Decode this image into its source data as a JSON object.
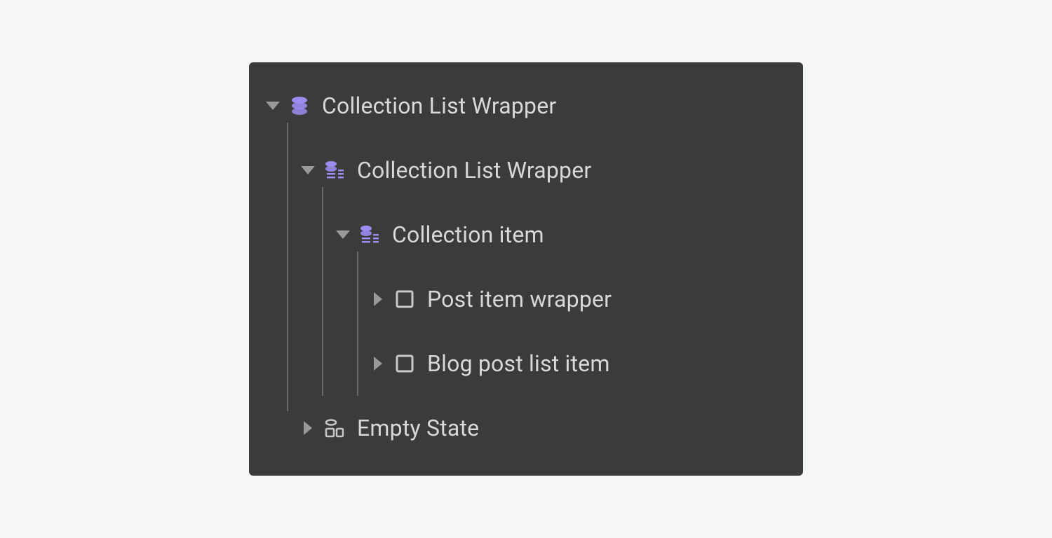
{
  "colors": {
    "panel_bg": "#3b3b3b",
    "text": "#d8d8d8",
    "guide_line": "#6b6b6b",
    "caret": "#9a9a9a",
    "icon_accent": "#9b8cf0",
    "icon_neutral": "#c8c8c8"
  },
  "tree": {
    "root": {
      "label": "Collection List Wrapper",
      "expanded": true,
      "icon": "database"
    },
    "child_list": {
      "label": "Collection List Wrapper",
      "expanded": true,
      "icon": "database-list"
    },
    "collection_item": {
      "label": "Collection item",
      "expanded": true,
      "icon": "database-list"
    },
    "post_item_wrapper": {
      "label": "Post item wrapper",
      "expanded": false,
      "icon": "box"
    },
    "blog_post_list_item": {
      "label": "Blog post list item",
      "expanded": false,
      "icon": "box"
    },
    "empty_state": {
      "label": "Empty State",
      "expanded": false,
      "icon": "empty-state"
    }
  }
}
